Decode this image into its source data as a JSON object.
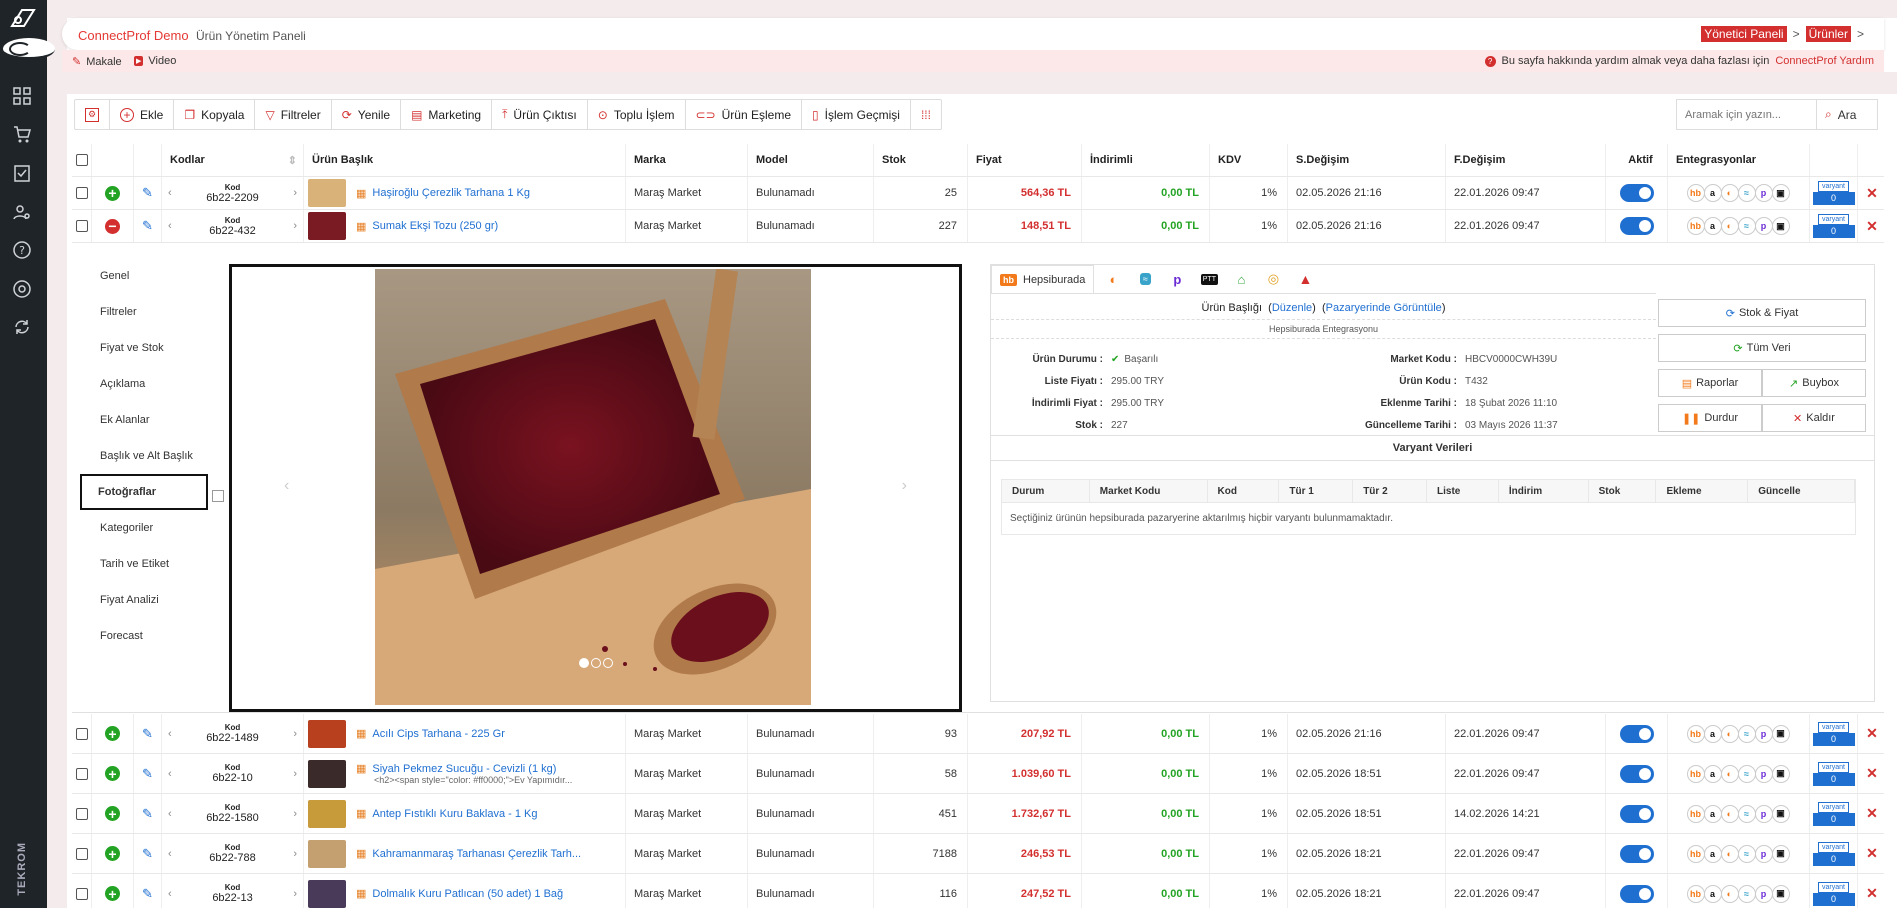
{
  "app": {
    "name": "ConnectProf Demo",
    "subtitle": "Ürün Yönetim Paneli",
    "brand_vertical": "TEKROM"
  },
  "breadcrumb": {
    "home": "Yönetici Paneli",
    "sep": ">",
    "current": "Ürünler",
    "sep2": ">"
  },
  "links": {
    "article": "Makale",
    "video": "Video"
  },
  "help": {
    "text": "Bu sayfa hakkında yardım almak veya daha fazlası için",
    "link": "ConnectProf Yardım"
  },
  "toolbar": {
    "add": "Ekle",
    "copy": "Kopyala",
    "filters": "Filtreler",
    "refresh": "Yenile",
    "marketing": "Marketing",
    "export": "Ürün Çıktısı",
    "bulk": "Toplu İşlem",
    "match": "Ürün Eşleme",
    "history": "İşlem Geçmişi"
  },
  "search": {
    "placeholder": "Aramak için yazın...",
    "button": "Ara"
  },
  "columns": {
    "codes": "Kodlar",
    "title": "Ürün Başlık",
    "brand": "Marka",
    "model": "Model",
    "stock": "Stok",
    "price": "Fiyat",
    "discounted": "İndirimli",
    "vat": "KDV",
    "modified": "S.Değişim",
    "price_changed": "F.Değişim",
    "active": "Aktif",
    "integrations": "Entegrasyonlar"
  },
  "kod_label": "Kod",
  "variant_label": "varyant",
  "rows_top": [
    {
      "code": "6b22-2209",
      "title": "Haşiroğlu Çerezlik Tarhana 1 Kg",
      "brand": "Maraş Market",
      "model": "Bulunamadı",
      "stock": "25",
      "price": "564,36 TL",
      "disc": "0,00 TL",
      "vat": "1%",
      "sdate": "02.05.2026 21:16",
      "fdate": "22.01.2026 09:47",
      "variants": "0",
      "expanded": false
    },
    {
      "code": "6b22-432",
      "title": "Sumak Ekşi Tozu (250 gr)",
      "brand": "Maraş Market",
      "model": "Bulunamadı",
      "stock": "227",
      "price": "148,51 TL",
      "disc": "0,00 TL",
      "vat": "1%",
      "sdate": "02.05.2026 21:16",
      "fdate": "22.01.2026 09:47",
      "variants": "0",
      "expanded": true
    }
  ],
  "rows_bottom": [
    {
      "code": "6b22-1489",
      "title": "Acılı Cips Tarhana - 225 Gr",
      "sub": "",
      "brand": "Maraş Market",
      "model": "Bulunamadı",
      "stock": "93",
      "price": "207,92 TL",
      "disc": "0,00 TL",
      "vat": "1%",
      "sdate": "02.05.2026 21:16",
      "fdate": "22.01.2026 09:47",
      "variants": "0"
    },
    {
      "code": "6b22-10",
      "title": "Siyah Pekmez Sucuğu - Cevizli (1 kg)",
      "sub": "<h2><span style=\"color: #ff0000;\">Ev Yapımıdır...",
      "brand": "Maraş Market",
      "model": "Bulunamadı",
      "stock": "58",
      "price": "1.039,60 TL",
      "disc": "0,00 TL",
      "vat": "1%",
      "sdate": "02.05.2026 18:51",
      "fdate": "22.01.2026 09:47",
      "variants": "0"
    },
    {
      "code": "6b22-1580",
      "title": "Antep Fıstıklı Kuru Baklava - 1 Kg",
      "sub": "",
      "brand": "Maraş Market",
      "model": "Bulunamadı",
      "stock": "451",
      "price": "1.732,67 TL",
      "disc": "0,00 TL",
      "vat": "1%",
      "sdate": "02.05.2026 18:51",
      "fdate": "14.02.2026 14:21",
      "variants": "0"
    },
    {
      "code": "6b22-788",
      "title": "Kahramanmaraş Tarhanası Çerezlik Tarh...",
      "sub": "",
      "brand": "Maraş Market",
      "model": "Bulunamadı",
      "stock": "7188",
      "price": "246,53 TL",
      "disc": "0,00 TL",
      "vat": "1%",
      "sdate": "02.05.2026 18:21",
      "fdate": "22.01.2026 09:47",
      "variants": "0"
    },
    {
      "code": "6b22-13",
      "title": "Dolmalık Kuru Patlıcan (50 adet) 1 Bağ",
      "sub": "",
      "brand": "Maraş Market",
      "model": "Bulunamadı",
      "stock": "116",
      "price": "247,52 TL",
      "disc": "0,00 TL",
      "vat": "1%",
      "sdate": "02.05.2026 18:21",
      "fdate": "22.01.2026 09:47",
      "variants": "0"
    }
  ],
  "detail_menu": [
    "Genel",
    "Filtreler",
    "Fiyat ve Stok",
    "Açıklama",
    "Ek Alanlar",
    "Başlık ve Alt Başlık",
    "Fotoğraflar",
    "Kategoriler",
    "Tarih ve Etiket",
    "Fiyat Analizi",
    "Forecast"
  ],
  "marketplace": {
    "tab": "Hepsiburada",
    "title_label": "Ürün Başlığı",
    "edit": "Düzenle",
    "view": "Pazaryerinde Görüntüle",
    "integration": "Hepsiburada Entegrasyonu",
    "left": [
      {
        "k": "Ürün Durumu :",
        "v": "Başarılı"
      },
      {
        "k": "Liste Fiyatı :",
        "v": "295.00 TRY"
      },
      {
        "k": "İndirimli Fiyat :",
        "v": "295.00 TRY"
      },
      {
        "k": "Stok :",
        "v": "227"
      }
    ],
    "right": [
      {
        "k": "Market Kodu :",
        "v": "HBCV0000CWH39U"
      },
      {
        "k": "Ürün Kodu :",
        "v": "T432"
      },
      {
        "k": "Eklenme Tarihi :",
        "v": "18 Şubat 2026 11:10"
      },
      {
        "k": "Güncelleme Tarihi :",
        "v": "03 Mayıs 2026 11:37"
      }
    ],
    "btn_stock": "Stok & Fiyat",
    "btn_all": "Tüm Veri",
    "btn_reports": "Raporlar",
    "btn_buybox": "Buybox",
    "btn_stop": "Durdur",
    "btn_remove": "Kaldır",
    "variants_title": "Varyant Verileri",
    "variant_cols": [
      "Durum",
      "Market Kodu",
      "Kod",
      "Tür 1",
      "Tür 2",
      "Liste",
      "İndirim",
      "Stok",
      "Ekleme",
      "Güncelle"
    ],
    "variant_empty": "Seçtiğiniz ürünün hepsiburada pazaryerine aktarılmış hiçbir varyantı bulunmamaktadır."
  },
  "colors": {
    "accent": "#d32f2f",
    "blue": "#1f6fd1",
    "green": "#23a323",
    "sidebar": "#1f2428"
  }
}
